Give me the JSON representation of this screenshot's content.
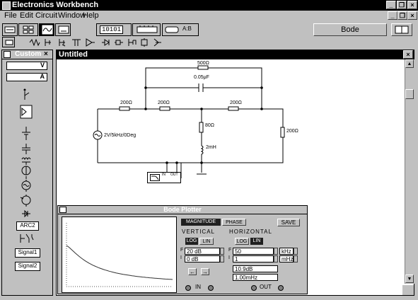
{
  "app": {
    "title": "Electronics Workbench"
  },
  "menu": [
    "File",
    "Edit",
    "Circuit",
    "Window",
    "Help"
  ],
  "toolbar": {
    "counter_label": "10101",
    "logic_label": "A:B",
    "instrument_panel_label": "Bode"
  },
  "palette": {
    "title": "Custom",
    "items": {
      "arc": "ARC2",
      "signal1": "Signal1",
      "signal2": "Signal2"
    },
    "slot1_mark": "V",
    "slot2_mark": "A"
  },
  "circuit_window": {
    "title": "Untitled",
    "components": {
      "r_top": "500Ω",
      "c_top": "0.05μF",
      "r_left": "200Ω",
      "r_mid": "200Ω",
      "r_right": "200Ω",
      "r_load": "200Ω",
      "r_series": "80Ω",
      "l_series": "2mH",
      "source": "2V/5kHz/0Deg"
    },
    "bode_block_labels": {
      "in": "IN",
      "out": "OUT"
    }
  },
  "bode_plotter": {
    "title": "Bode Plotter",
    "magnitude_label": "MAGNITUDE",
    "phase_label": "PHASE",
    "save_label": "SAVE",
    "vertical": {
      "label": "VERTICAL",
      "log": "LOG",
      "lin": "LIN",
      "final_prefix": "F",
      "initial_prefix": "I",
      "final_value": "20 dB",
      "initial_value": "0 dB"
    },
    "horizontal": {
      "label": "HORIZONTAL",
      "log": "LOG",
      "lin": "LIN",
      "final_prefix": "F",
      "initial_prefix": "I",
      "final_value": "50",
      "initial_value": "1",
      "final_unit": "kHz",
      "initial_unit": "mHz"
    },
    "readout_db": "10.9dB",
    "readout_freq": "1.00mHz",
    "in_label": "IN",
    "out_label": "OUT",
    "plot_color": "#333333"
  }
}
